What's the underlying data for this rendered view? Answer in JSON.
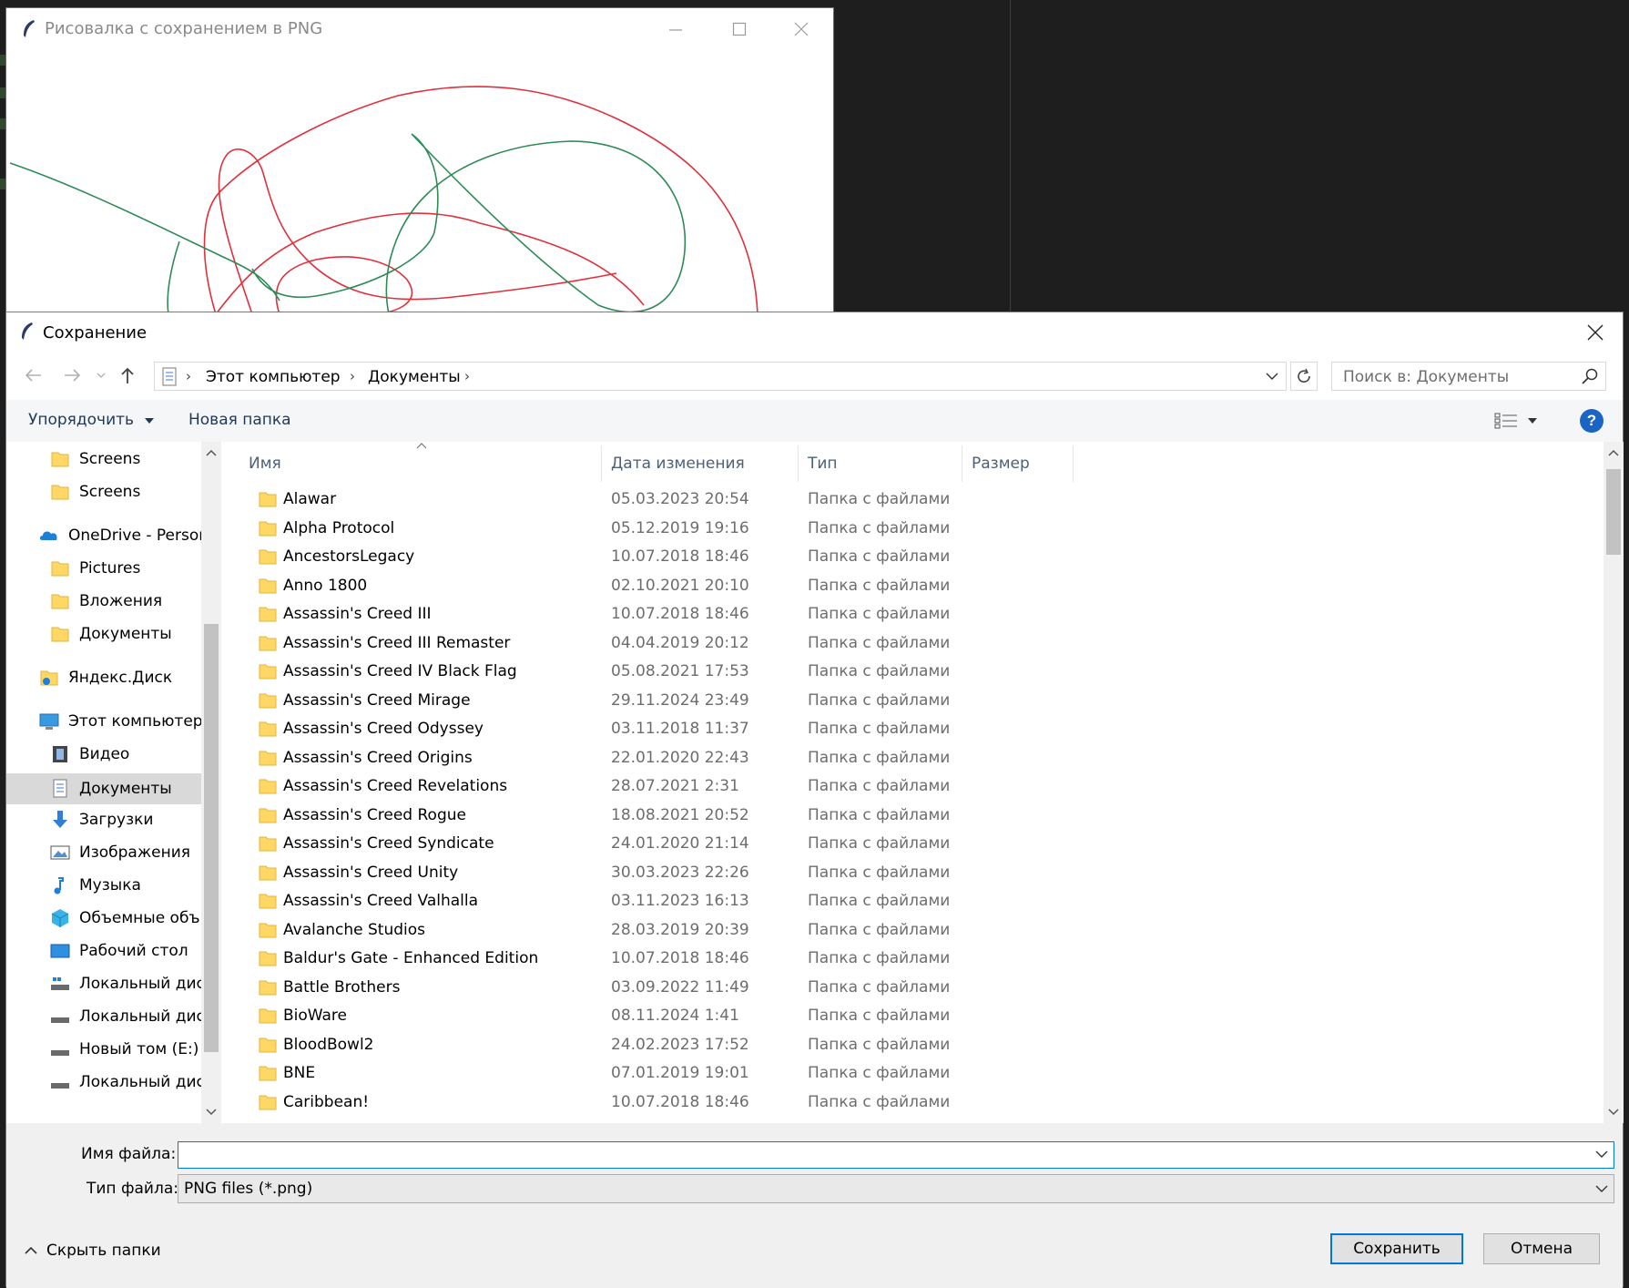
{
  "paint_window": {
    "title": "Рисовалка с сохранением в PNG",
    "stroke_colors": [
      "#e0303c",
      "#2e8b57"
    ]
  },
  "dialog": {
    "title": "Сохранение",
    "breadcrumb": [
      "Этот компьютер",
      "Документы"
    ],
    "search_placeholder": "Поиск в: Документы",
    "toolbar": {
      "organize": "Упорядочить",
      "new_folder": "Новая папка"
    },
    "nav_items": [
      {
        "label": "Screens",
        "icon": "folder-icon"
      },
      {
        "label": "Screens",
        "icon": "folder-icon"
      },
      {
        "label": "OneDrive - Person",
        "icon": "cloud-icon"
      },
      {
        "label": "Pictures",
        "icon": "folder-icon"
      },
      {
        "label": "Вложения",
        "icon": "folder-icon"
      },
      {
        "label": "Документы",
        "icon": "folder-icon"
      },
      {
        "label": "Яндекс.Диск",
        "icon": "yandex-disk-icon"
      },
      {
        "label": "Этот компьютер",
        "icon": "computer-icon"
      },
      {
        "label": "Видео",
        "icon": "video-icon"
      },
      {
        "label": "Документы",
        "icon": "documents-icon",
        "selected": true
      },
      {
        "label": "Загрузки",
        "icon": "download-icon"
      },
      {
        "label": "Изображения",
        "icon": "pictures-icon"
      },
      {
        "label": "Музыка",
        "icon": "music-icon"
      },
      {
        "label": "Объемные объ",
        "icon": "3d-objects-icon"
      },
      {
        "label": "Рабочий стол",
        "icon": "desktop-icon"
      },
      {
        "label": "Локальный дис",
        "icon": "drive-icon"
      },
      {
        "label": "Локальный дис",
        "icon": "drive-icon"
      },
      {
        "label": "Новый том (E:)",
        "icon": "drive-icon"
      },
      {
        "label": "Локальный дис",
        "icon": "drive-icon"
      }
    ],
    "columns": [
      "Имя",
      "Дата изменения",
      "Тип",
      "Размер"
    ],
    "files": [
      {
        "name": "Alawar",
        "date": "05.03.2023 20:54",
        "type": "Папка с файлами"
      },
      {
        "name": "Alpha Protocol",
        "date": "05.12.2019 19:16",
        "type": "Папка с файлами"
      },
      {
        "name": "AncestorsLegacy",
        "date": "10.07.2018 18:46",
        "type": "Папка с файлами"
      },
      {
        "name": "Anno 1800",
        "date": "02.10.2021 20:10",
        "type": "Папка с файлами"
      },
      {
        "name": "Assassin's Creed III",
        "date": "10.07.2018 18:46",
        "type": "Папка с файлами"
      },
      {
        "name": "Assassin's Creed III Remaster",
        "date": "04.04.2019 20:12",
        "type": "Папка с файлами"
      },
      {
        "name": "Assassin's Creed IV Black Flag",
        "date": "05.08.2021 17:53",
        "type": "Папка с файлами"
      },
      {
        "name": "Assassin's Creed Mirage",
        "date": "29.11.2024 23:49",
        "type": "Папка с файлами"
      },
      {
        "name": "Assassin's Creed Odyssey",
        "date": "03.11.2018 11:37",
        "type": "Папка с файлами"
      },
      {
        "name": "Assassin's Creed Origins",
        "date": "22.01.2020 22:43",
        "type": "Папка с файлами"
      },
      {
        "name": "Assassin's Creed Revelations",
        "date": "28.07.2021 2:31",
        "type": "Папка с файлами"
      },
      {
        "name": "Assassin's Creed Rogue",
        "date": "18.08.2021 20:52",
        "type": "Папка с файлами"
      },
      {
        "name": "Assassin's Creed Syndicate",
        "date": "24.01.2020 21:14",
        "type": "Папка с файлами"
      },
      {
        "name": "Assassin's Creed Unity",
        "date": "30.03.2023 22:26",
        "type": "Папка с файлами"
      },
      {
        "name": "Assassin's Creed Valhalla",
        "date": "03.11.2023 16:13",
        "type": "Папка с файлами"
      },
      {
        "name": "Avalanche Studios",
        "date": "28.03.2019 20:39",
        "type": "Папка с файлами"
      },
      {
        "name": "Baldur's Gate - Enhanced Edition",
        "date": "10.07.2018 18:46",
        "type": "Папка с файлами"
      },
      {
        "name": "Battle Brothers",
        "date": "03.09.2022 11:49",
        "type": "Папка с файлами"
      },
      {
        "name": "BioWare",
        "date": "08.11.2024 1:41",
        "type": "Папка с файлами"
      },
      {
        "name": "BloodBowl2",
        "date": "24.02.2023 17:52",
        "type": "Папка с файлами"
      },
      {
        "name": "BNE",
        "date": "07.01.2019 19:01",
        "type": "Папка с файлами"
      },
      {
        "name": "Caribbean!",
        "date": "10.07.2018 18:46",
        "type": "Папка с файлами"
      }
    ],
    "filename_label": "Имя файла:",
    "filename_value": "",
    "filetype_label": "Тип файла:",
    "filetype_value": "PNG files (*.png)",
    "hide_folders": "Скрыть папки",
    "save_button": "Сохранить",
    "cancel_button": "Отмена",
    "colors": {
      "accent": "#0078d7",
      "folder": "#ffd764",
      "help": "#1a64c4"
    }
  }
}
